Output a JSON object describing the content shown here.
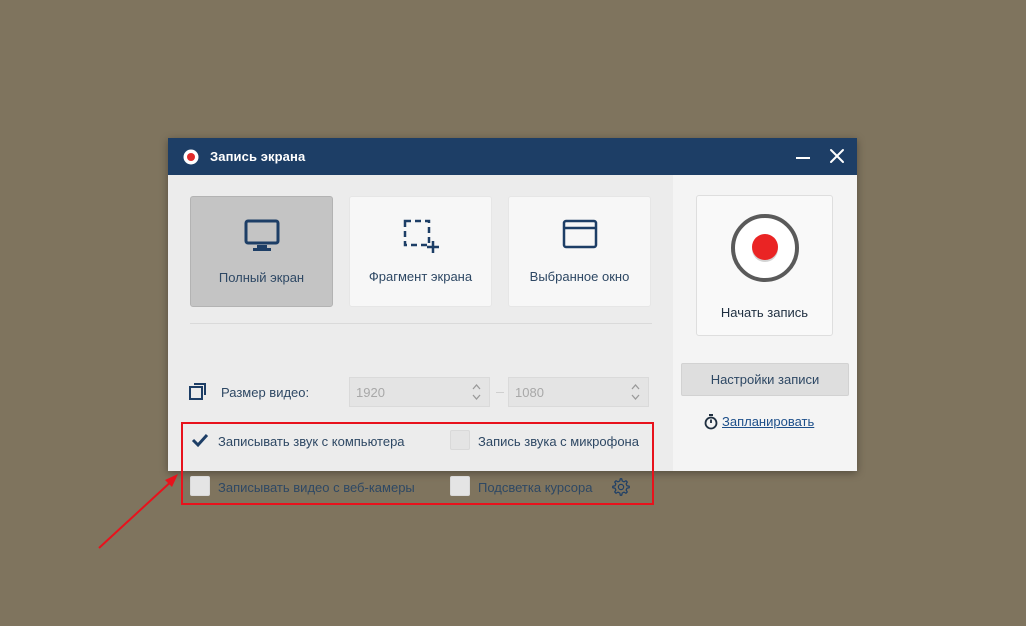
{
  "window": {
    "title": "Запись экрана",
    "title_color": "#1d3e66",
    "accent_red": "#e8121c"
  },
  "modes": [
    {
      "label": "Полный экран",
      "icon": "monitor-icon",
      "selected": true
    },
    {
      "label": "Фрагмент экрана",
      "icon": "selection-add-icon",
      "selected": false
    },
    {
      "label": "Выбранное окно",
      "icon": "window-icon",
      "selected": false
    }
  ],
  "video_size": {
    "label": "Размер видео:",
    "width": "1920",
    "height": "1080"
  },
  "options": [
    {
      "label": "Записывать звук с компьютера",
      "checked": true
    },
    {
      "label": "Запись звука с микрофона",
      "checked": false
    },
    {
      "label": "Записывать видео с веб-камеры",
      "checked": false
    },
    {
      "label": "Подсветка курсора",
      "checked": false,
      "has_settings": true
    }
  ],
  "actions": {
    "start_label": "Начать запись",
    "settings_label": "Настройки записи",
    "schedule_label": "Запланировать"
  }
}
